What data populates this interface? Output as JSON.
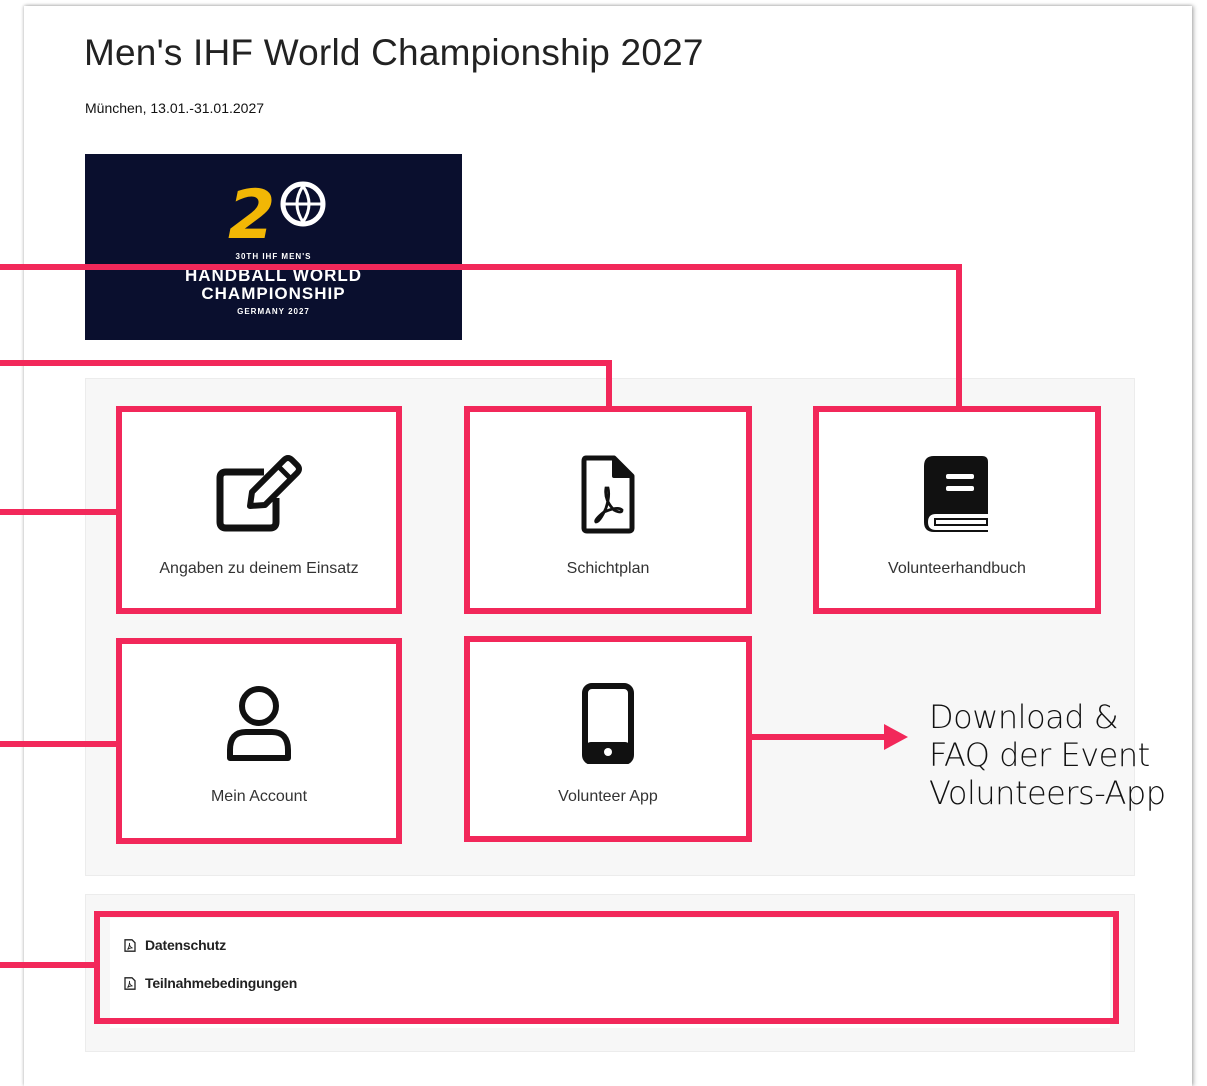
{
  "event": {
    "title": "Men's IHF World Championship 2027",
    "subtitle": "München, 13.01.-31.01.2027"
  },
  "logo": {
    "line1": "30TH IHF MEN'S",
    "line2": "HANDBALL WORLD",
    "line3": "CHAMPIONSHIP",
    "line4": "GERMANY 2027",
    "numeral": "2"
  },
  "tiles": [
    {
      "label": "Angaben zu deinem Einsatz",
      "icon": "edit-icon"
    },
    {
      "label": "Schichtplan",
      "icon": "pdf-file-icon"
    },
    {
      "label": "Volunteerhandbuch",
      "icon": "book-icon"
    },
    {
      "label": "Mein Account",
      "icon": "user-icon"
    },
    {
      "label": "Volunteer App",
      "icon": "mobile-phone-icon"
    }
  ],
  "links": [
    {
      "label": "Datenschutz",
      "icon": "pdf-icon"
    },
    {
      "label": "Teilnahmebedingungen",
      "icon": "pdf-icon"
    }
  ],
  "annotation": {
    "text": "Download &\nFAQ der Event\nVolunteers-App"
  },
  "colors": {
    "highlight": "#f2285a",
    "logo_background": "#0a0f2e",
    "logo_accent": "#f2b705"
  }
}
